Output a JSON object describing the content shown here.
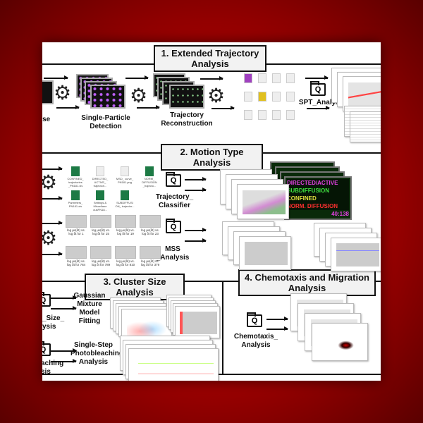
{
  "sections": {
    "s1": {
      "title": "1. Extended Trajectory Analysis"
    },
    "s2": {
      "title": "2. Motion Type Analysis"
    },
    "s3": {
      "title": "3. Cluster Size Analysis"
    },
    "s4": {
      "title": "4. Chemotaxis and Migration Analysis"
    }
  },
  "labels": {
    "timelapse_a": "ose",
    "timelapse_b": "s",
    "detection": "Single-Particle Detection",
    "reconstruction": "Trajectory Reconstruction",
    "spt": "SPT_Analysis",
    "classifier": "Trajectory_ Classifier",
    "mss": "MSS _Analysis",
    "cluster_a": "_Size_",
    "cluster_b": "ysis",
    "gmm": "Gaussian Mixture Model Fitting",
    "bleach_a": "aching",
    "bleach_b": "sis",
    "ssp": "Single-Step Photobleaching Analysis",
    "chemotaxis": "Chemotaxis_ Analysis"
  },
  "files": [
    {
      "name": "CONFINED_ trajectories _PN181.xls",
      "icon": "excel-icon"
    },
    {
      "name": "DIRECTED_ ACTIVE_ trajectori...",
      "icon": "document-icon"
    },
    {
      "name": "MSD_ curve_ PN181.png",
      "icon": "image-icon"
    },
    {
      "name": "NORM_ DIFFUSION _trajecto...",
      "icon": "excel-icon"
    },
    {
      "name": "Parmeters_ PN181.xls",
      "icon": "excel-icon"
    },
    {
      "name": "Settings & Miscellane ousPN18...",
      "icon": "excel-icon"
    },
    {
      "name": "SUBDIFFUSI ON_ trajector...",
      "icon": "excel-icon"
    }
  ],
  "mss_thumbs": [
    "log µv(δt) vs. log δt for 1",
    "log µv(δt) vs. log δt for 15",
    "log µv(δt) vs. log δt for 19",
    "log µv(δt) vs. log δt for 23",
    "log µv(δt) vs. log δt for 784",
    "log µv(δt) vs. log δt for 789",
    "log µv(δt) vs. log δt for 810",
    "log µv(δt) vs. log δt for 379"
  ],
  "motion_types": [
    {
      "label": "DIRECTED/ACTIVE",
      "color": "#e040e0"
    },
    {
      "label": "SUBDIFFUSION",
      "color": "#40e040"
    },
    {
      "label": "CONFINED",
      "color": "#e0e040"
    },
    {
      "label": "NORM. DIFFUSION",
      "color": "#ff3030"
    }
  ],
  "screen_counter": "40:138",
  "colors": {
    "background": "#c00000",
    "panel": "#ffffff"
  }
}
